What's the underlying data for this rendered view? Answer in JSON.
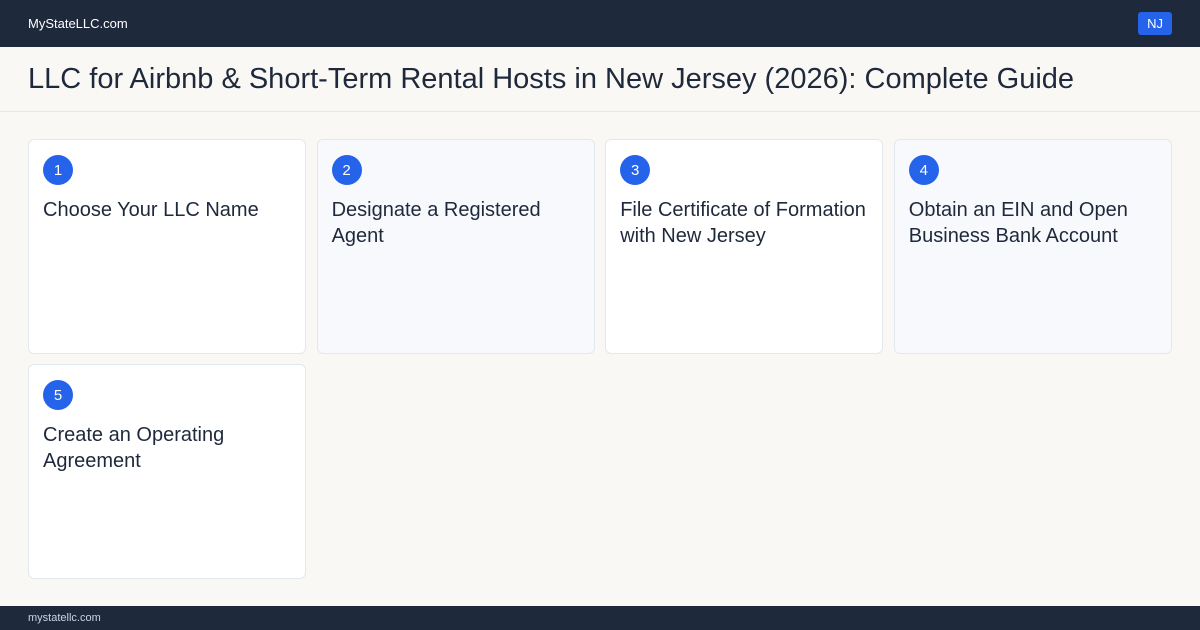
{
  "header": {
    "brand": "MyStateLLC.com",
    "state_badge": "NJ"
  },
  "title": "LLC for Airbnb & Short-Term Rental Hosts in New Jersey (2026): Complete Guide",
  "steps": [
    {
      "number": "1",
      "title": "Choose Your LLC Name"
    },
    {
      "number": "2",
      "title": "Designate a Registered Agent"
    },
    {
      "number": "3",
      "title": "File Certificate of Formation with New Jersey"
    },
    {
      "number": "4",
      "title": "Obtain an EIN and Open Business Bank Account"
    },
    {
      "number": "5",
      "title": "Create an Operating Agreement"
    }
  ],
  "footer": {
    "domain": "mystatellc.com"
  },
  "colors": {
    "navy": "#1e293b",
    "accent_blue": "#2563eb",
    "background": "#faf8f4"
  }
}
